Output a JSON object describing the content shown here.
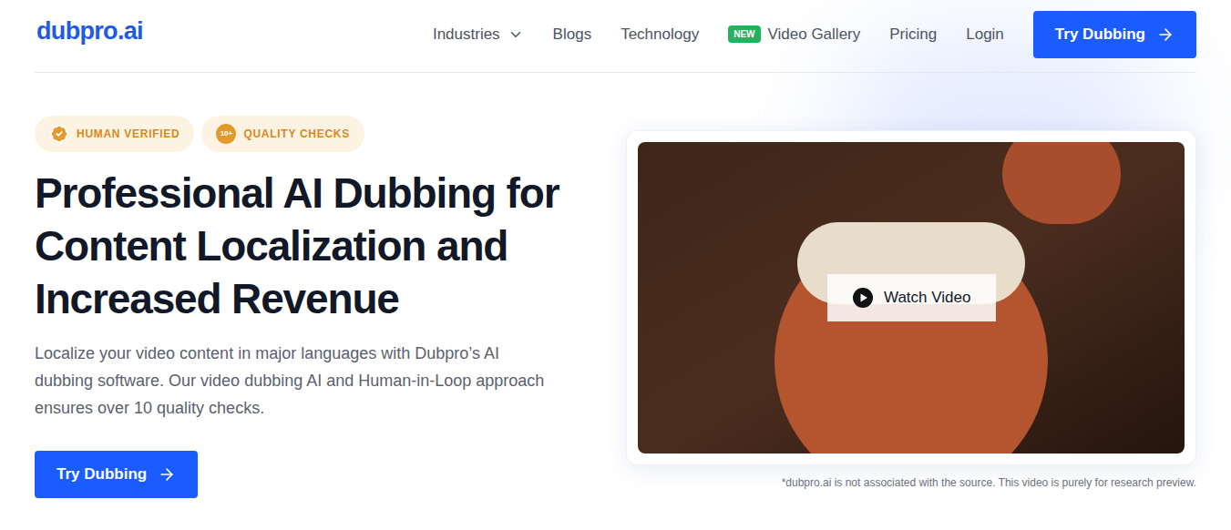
{
  "logo": "dubpro.ai",
  "nav": {
    "items": [
      {
        "label": "Industries",
        "has_dropdown": true,
        "badge": null
      },
      {
        "label": "Blogs",
        "has_dropdown": false,
        "badge": null
      },
      {
        "label": "Technology",
        "has_dropdown": false,
        "badge": null
      },
      {
        "label": "Video Gallery",
        "has_dropdown": false,
        "badge": "NEW"
      },
      {
        "label": "Pricing",
        "has_dropdown": false,
        "badge": null
      },
      {
        "label": "Login",
        "has_dropdown": false,
        "badge": null
      }
    ],
    "cta": "Try Dubbing"
  },
  "badges": [
    {
      "label": "HUMAN VERIFIED",
      "kind": "verified",
      "icon_text": null
    },
    {
      "label": "QUALITY CHECKS",
      "kind": "count",
      "icon_text": "10+"
    }
  ],
  "hero": {
    "heading_lines": [
      "Professional AI Dubbing for",
      "Content Localization and",
      "Increased Revenue"
    ],
    "description": "Localize your video content in major languages with Dubpro’s AI dubbing software. Our video dubbing AI and Human-in-Loop approach ensures over 10 quality checks.",
    "button": "Try Dubbing"
  },
  "video": {
    "play_label": "Watch Video",
    "disclaimer": "*dubpro.ai is not associated with the source. This video is purely for research preview."
  }
}
